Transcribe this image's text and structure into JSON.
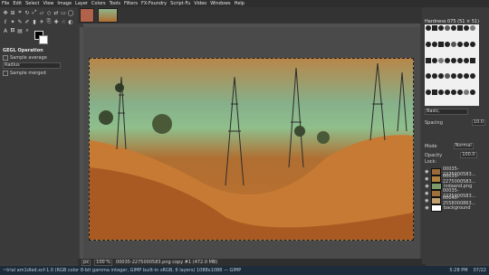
{
  "menu": [
    "File",
    "Edit",
    "Select",
    "View",
    "Image",
    "Layer",
    "Colors",
    "Tools",
    "Filters",
    "FX-Foundry",
    "Script-Fu",
    "Video",
    "Windows",
    "Help"
  ],
  "tools": [
    "move-icon",
    "align-icon",
    "crop-icon",
    "rotate-icon",
    "scale-icon",
    "shear-icon",
    "perspective-icon",
    "flip-icon",
    "rect-select-icon",
    "ellipse-select-icon",
    "lasso-icon",
    "fuzzy-select-icon",
    "pencil-icon",
    "paintbrush-icon",
    "eraser-icon",
    "airbrush-icon",
    "clone-icon",
    "heal-icon",
    "smudge-icon",
    "dodge-icon",
    "text-icon",
    "bucket-icon",
    "gradient-icon",
    "zoom-icon"
  ],
  "tool_options": {
    "title": "GEGL Operation",
    "sample_label": "Sample average",
    "radius_label": "Radius",
    "sample_merged": "Sample merged"
  },
  "brushes": {
    "title": "Hardness 075 (51 × 51)",
    "filter_placeholder": "Basic,",
    "spacing_label": "Spacing",
    "spacing_value": "10.0"
  },
  "layers": {
    "mode_label": "Mode",
    "mode_value": "Normal",
    "opacity_label": "Opacity",
    "opacity_value": "100.0",
    "lock_label": "Lock:",
    "items": [
      {
        "name": "00035-2275000583...",
        "visible": "true"
      },
      {
        "name": "00035-2275000583...",
        "visible": "true"
      },
      {
        "name": "indaand.png",
        "visible": "true"
      },
      {
        "name": "00035-2275000583...",
        "visible": "true"
      },
      {
        "name": "00040-2558000863...",
        "visible": "true"
      },
      {
        "name": "background",
        "visible": "true"
      }
    ]
  },
  "status": {
    "unit": "px",
    "zoom": "100 %",
    "info": "00035-2275000583.png copy #1 (472.0 MB)"
  },
  "window_title_line": "~trial am1dled.xcf-1.0 (RGB color 8-bit gamma integer, GIMP built-in sRGB, 6 layers) 1088x1088 — GIMP",
  "taskbar": {
    "time": "5:28 PM",
    "date": "07/22"
  }
}
